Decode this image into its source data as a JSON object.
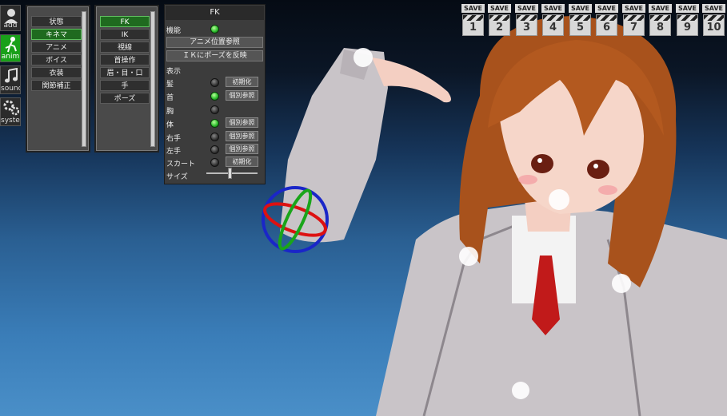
{
  "side_menu": [
    {
      "icon": "person-add-icon",
      "label": "add",
      "active": false
    },
    {
      "icon": "running-figure-icon",
      "label": "anim",
      "active": true
    },
    {
      "icon": "music-note-icon",
      "label": "sound",
      "active": false
    },
    {
      "icon": "gears-icon",
      "label": "system",
      "active": false
    }
  ],
  "category_menu": {
    "items": [
      "状態",
      "キネマ",
      "アニメ",
      "ボイス",
      "衣装",
      "関節補正"
    ],
    "selected": "キネマ"
  },
  "kinema_menu": {
    "items": [
      "FK",
      "IK",
      "視線",
      "首操作",
      "眉・目・口",
      "手",
      "ポーズ"
    ],
    "selected": "FK"
  },
  "fk_panel": {
    "title": "FK",
    "function_label": "機能",
    "anim_ref_button": "アニメ位置参照",
    "ik_pose_button": "ＩＫにポーズを反映",
    "display_label": "表示",
    "parts": [
      {
        "label": "髪",
        "state": "off",
        "button": "初期化"
      },
      {
        "label": "首",
        "state": "on",
        "button": "個別参照"
      },
      {
        "label": "胸",
        "state": "off",
        "button": ""
      },
      {
        "label": "体",
        "state": "on",
        "button": "個別参照"
      },
      {
        "label": "右手",
        "state": "off",
        "button": "個別参照"
      },
      {
        "label": "左手",
        "state": "off",
        "button": "個別参照"
      },
      {
        "label": "スカート",
        "state": "off",
        "button": "初期化"
      }
    ],
    "size_label": "サイズ",
    "size_value": 0.45
  },
  "save_slots": {
    "label": "SAVE",
    "numbers": [
      "1",
      "2",
      "3",
      "4",
      "5",
      "6",
      "7",
      "8",
      "9",
      "10"
    ]
  }
}
